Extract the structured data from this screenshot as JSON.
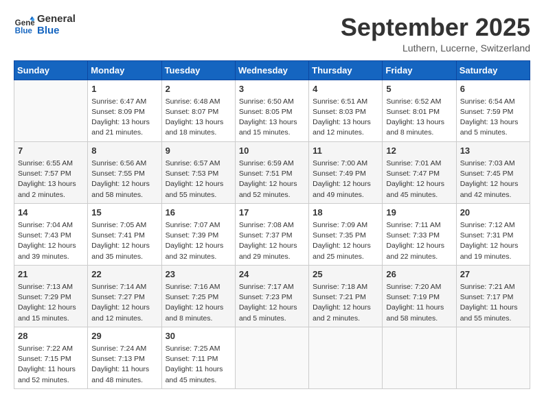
{
  "logo": {
    "line1": "General",
    "line2": "Blue"
  },
  "title": "September 2025",
  "subtitle": "Luthern, Lucerne, Switzerland",
  "weekdays": [
    "Sunday",
    "Monday",
    "Tuesday",
    "Wednesday",
    "Thursday",
    "Friday",
    "Saturday"
  ],
  "weeks": [
    [
      {
        "day": "",
        "info": ""
      },
      {
        "day": "1",
        "info": "Sunrise: 6:47 AM\nSunset: 8:09 PM\nDaylight: 13 hours\nand 21 minutes."
      },
      {
        "day": "2",
        "info": "Sunrise: 6:48 AM\nSunset: 8:07 PM\nDaylight: 13 hours\nand 18 minutes."
      },
      {
        "day": "3",
        "info": "Sunrise: 6:50 AM\nSunset: 8:05 PM\nDaylight: 13 hours\nand 15 minutes."
      },
      {
        "day": "4",
        "info": "Sunrise: 6:51 AM\nSunset: 8:03 PM\nDaylight: 13 hours\nand 12 minutes."
      },
      {
        "day": "5",
        "info": "Sunrise: 6:52 AM\nSunset: 8:01 PM\nDaylight: 13 hours\nand 8 minutes."
      },
      {
        "day": "6",
        "info": "Sunrise: 6:54 AM\nSunset: 7:59 PM\nDaylight: 13 hours\nand 5 minutes."
      }
    ],
    [
      {
        "day": "7",
        "info": "Sunrise: 6:55 AM\nSunset: 7:57 PM\nDaylight: 13 hours\nand 2 minutes."
      },
      {
        "day": "8",
        "info": "Sunrise: 6:56 AM\nSunset: 7:55 PM\nDaylight: 12 hours\nand 58 minutes."
      },
      {
        "day": "9",
        "info": "Sunrise: 6:57 AM\nSunset: 7:53 PM\nDaylight: 12 hours\nand 55 minutes."
      },
      {
        "day": "10",
        "info": "Sunrise: 6:59 AM\nSunset: 7:51 PM\nDaylight: 12 hours\nand 52 minutes."
      },
      {
        "day": "11",
        "info": "Sunrise: 7:00 AM\nSunset: 7:49 PM\nDaylight: 12 hours\nand 49 minutes."
      },
      {
        "day": "12",
        "info": "Sunrise: 7:01 AM\nSunset: 7:47 PM\nDaylight: 12 hours\nand 45 minutes."
      },
      {
        "day": "13",
        "info": "Sunrise: 7:03 AM\nSunset: 7:45 PM\nDaylight: 12 hours\nand 42 minutes."
      }
    ],
    [
      {
        "day": "14",
        "info": "Sunrise: 7:04 AM\nSunset: 7:43 PM\nDaylight: 12 hours\nand 39 minutes."
      },
      {
        "day": "15",
        "info": "Sunrise: 7:05 AM\nSunset: 7:41 PM\nDaylight: 12 hours\nand 35 minutes."
      },
      {
        "day": "16",
        "info": "Sunrise: 7:07 AM\nSunset: 7:39 PM\nDaylight: 12 hours\nand 32 minutes."
      },
      {
        "day": "17",
        "info": "Sunrise: 7:08 AM\nSunset: 7:37 PM\nDaylight: 12 hours\nand 29 minutes."
      },
      {
        "day": "18",
        "info": "Sunrise: 7:09 AM\nSunset: 7:35 PM\nDaylight: 12 hours\nand 25 minutes."
      },
      {
        "day": "19",
        "info": "Sunrise: 7:11 AM\nSunset: 7:33 PM\nDaylight: 12 hours\nand 22 minutes."
      },
      {
        "day": "20",
        "info": "Sunrise: 7:12 AM\nSunset: 7:31 PM\nDaylight: 12 hours\nand 19 minutes."
      }
    ],
    [
      {
        "day": "21",
        "info": "Sunrise: 7:13 AM\nSunset: 7:29 PM\nDaylight: 12 hours\nand 15 minutes."
      },
      {
        "day": "22",
        "info": "Sunrise: 7:14 AM\nSunset: 7:27 PM\nDaylight: 12 hours\nand 12 minutes."
      },
      {
        "day": "23",
        "info": "Sunrise: 7:16 AM\nSunset: 7:25 PM\nDaylight: 12 hours\nand 8 minutes."
      },
      {
        "day": "24",
        "info": "Sunrise: 7:17 AM\nSunset: 7:23 PM\nDaylight: 12 hours\nand 5 minutes."
      },
      {
        "day": "25",
        "info": "Sunrise: 7:18 AM\nSunset: 7:21 PM\nDaylight: 12 hours\nand 2 minutes."
      },
      {
        "day": "26",
        "info": "Sunrise: 7:20 AM\nSunset: 7:19 PM\nDaylight: 11 hours\nand 58 minutes."
      },
      {
        "day": "27",
        "info": "Sunrise: 7:21 AM\nSunset: 7:17 PM\nDaylight: 11 hours\nand 55 minutes."
      }
    ],
    [
      {
        "day": "28",
        "info": "Sunrise: 7:22 AM\nSunset: 7:15 PM\nDaylight: 11 hours\nand 52 minutes."
      },
      {
        "day": "29",
        "info": "Sunrise: 7:24 AM\nSunset: 7:13 PM\nDaylight: 11 hours\nand 48 minutes."
      },
      {
        "day": "30",
        "info": "Sunrise: 7:25 AM\nSunset: 7:11 PM\nDaylight: 11 hours\nand 45 minutes."
      },
      {
        "day": "",
        "info": ""
      },
      {
        "day": "",
        "info": ""
      },
      {
        "day": "",
        "info": ""
      },
      {
        "day": "",
        "info": ""
      }
    ]
  ]
}
